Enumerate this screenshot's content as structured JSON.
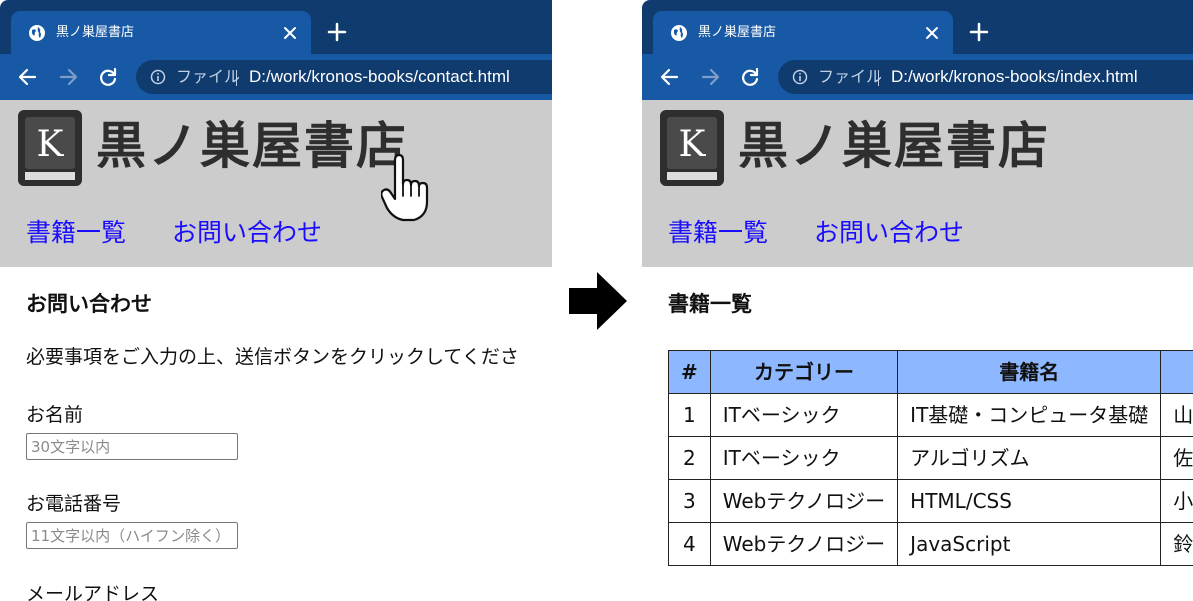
{
  "left_window": {
    "tab_title": "黒ノ巣屋書店",
    "address_scheme_label": "ファイル",
    "address_url": "D:/work/kronos-books/contact.html",
    "site": {
      "logo_letter": "K",
      "logo_text": "黒ノ巣屋書店",
      "nav": [
        "書籍一覧",
        "お問い合わせ"
      ]
    },
    "page": {
      "heading": "お問い合わせ",
      "intro": "必要事項をご入力の上、送信ボタンをクリックしてくださ",
      "fields": [
        {
          "label": "お名前",
          "placeholder": "30文字以内"
        },
        {
          "label": "お電話番号",
          "placeholder": "11文字以内（ハイフン除く）"
        },
        {
          "label": "メールアドレス"
        }
      ]
    }
  },
  "right_window": {
    "tab_title": "黒ノ巣屋書店",
    "address_scheme_label": "ファイル",
    "address_url": "D:/work/kronos-books/index.html",
    "site": {
      "logo_letter": "K",
      "logo_text": "黒ノ巣屋書店",
      "nav": [
        "書籍一覧",
        "お問い合わせ"
      ]
    },
    "page": {
      "heading": "書籍一覧",
      "table": {
        "headers": [
          "#",
          "カテゴリー",
          "書籍名",
          ""
        ],
        "rows": [
          [
            "1",
            "ITベーシック",
            "IT基礎・コンピュータ基礎",
            "山"
          ],
          [
            "2",
            "ITベーシック",
            "アルゴリズム",
            "佐"
          ],
          [
            "3",
            "Webテクノロジー",
            "HTML/CSS",
            "小"
          ],
          [
            "4",
            "Webテクノロジー",
            "JavaScript",
            "鈴"
          ]
        ]
      }
    }
  },
  "colors": {
    "tab_strip": "#0f3b6f",
    "toolbar": "#1859a6",
    "header_bg": "#cccccc",
    "link": "#1a0dff",
    "table_header": "#8db8ff"
  },
  "icons": [
    "globe-icon",
    "close-icon",
    "plus-icon",
    "back-arrow-icon",
    "forward-arrow-icon",
    "reload-icon",
    "info-icon",
    "book-logo-icon",
    "hand-pointer-icon",
    "right-arrow-icon"
  ]
}
